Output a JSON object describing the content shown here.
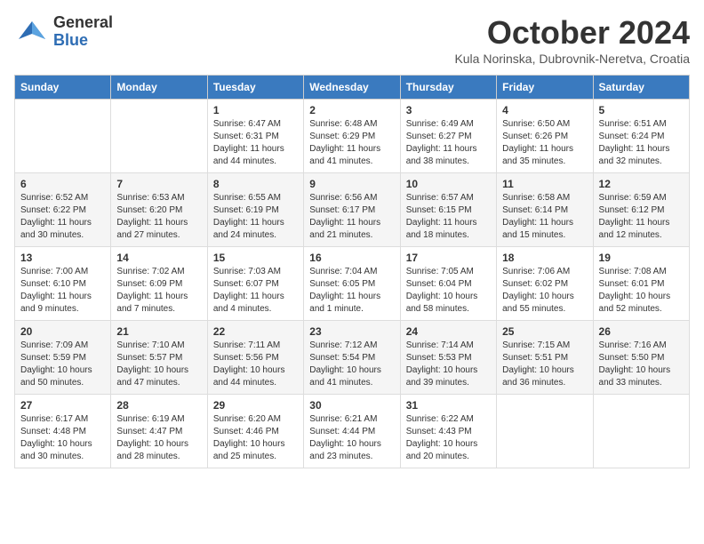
{
  "header": {
    "logo_general": "General",
    "logo_blue": "Blue",
    "month": "October 2024",
    "location": "Kula Norinska, Dubrovnik-Neretva, Croatia"
  },
  "days_of_week": [
    "Sunday",
    "Monday",
    "Tuesday",
    "Wednesday",
    "Thursday",
    "Friday",
    "Saturday"
  ],
  "weeks": [
    [
      {
        "day": "",
        "info": ""
      },
      {
        "day": "",
        "info": ""
      },
      {
        "day": "1",
        "info": "Sunrise: 6:47 AM\nSunset: 6:31 PM\nDaylight: 11 hours and 44 minutes."
      },
      {
        "day": "2",
        "info": "Sunrise: 6:48 AM\nSunset: 6:29 PM\nDaylight: 11 hours and 41 minutes."
      },
      {
        "day": "3",
        "info": "Sunrise: 6:49 AM\nSunset: 6:27 PM\nDaylight: 11 hours and 38 minutes."
      },
      {
        "day": "4",
        "info": "Sunrise: 6:50 AM\nSunset: 6:26 PM\nDaylight: 11 hours and 35 minutes."
      },
      {
        "day": "5",
        "info": "Sunrise: 6:51 AM\nSunset: 6:24 PM\nDaylight: 11 hours and 32 minutes."
      }
    ],
    [
      {
        "day": "6",
        "info": "Sunrise: 6:52 AM\nSunset: 6:22 PM\nDaylight: 11 hours and 30 minutes."
      },
      {
        "day": "7",
        "info": "Sunrise: 6:53 AM\nSunset: 6:20 PM\nDaylight: 11 hours and 27 minutes."
      },
      {
        "day": "8",
        "info": "Sunrise: 6:55 AM\nSunset: 6:19 PM\nDaylight: 11 hours and 24 minutes."
      },
      {
        "day": "9",
        "info": "Sunrise: 6:56 AM\nSunset: 6:17 PM\nDaylight: 11 hours and 21 minutes."
      },
      {
        "day": "10",
        "info": "Sunrise: 6:57 AM\nSunset: 6:15 PM\nDaylight: 11 hours and 18 minutes."
      },
      {
        "day": "11",
        "info": "Sunrise: 6:58 AM\nSunset: 6:14 PM\nDaylight: 11 hours and 15 minutes."
      },
      {
        "day": "12",
        "info": "Sunrise: 6:59 AM\nSunset: 6:12 PM\nDaylight: 11 hours and 12 minutes."
      }
    ],
    [
      {
        "day": "13",
        "info": "Sunrise: 7:00 AM\nSunset: 6:10 PM\nDaylight: 11 hours and 9 minutes."
      },
      {
        "day": "14",
        "info": "Sunrise: 7:02 AM\nSunset: 6:09 PM\nDaylight: 11 hours and 7 minutes."
      },
      {
        "day": "15",
        "info": "Sunrise: 7:03 AM\nSunset: 6:07 PM\nDaylight: 11 hours and 4 minutes."
      },
      {
        "day": "16",
        "info": "Sunrise: 7:04 AM\nSunset: 6:05 PM\nDaylight: 11 hours and 1 minute."
      },
      {
        "day": "17",
        "info": "Sunrise: 7:05 AM\nSunset: 6:04 PM\nDaylight: 10 hours and 58 minutes."
      },
      {
        "day": "18",
        "info": "Sunrise: 7:06 AM\nSunset: 6:02 PM\nDaylight: 10 hours and 55 minutes."
      },
      {
        "day": "19",
        "info": "Sunrise: 7:08 AM\nSunset: 6:01 PM\nDaylight: 10 hours and 52 minutes."
      }
    ],
    [
      {
        "day": "20",
        "info": "Sunrise: 7:09 AM\nSunset: 5:59 PM\nDaylight: 10 hours and 50 minutes."
      },
      {
        "day": "21",
        "info": "Sunrise: 7:10 AM\nSunset: 5:57 PM\nDaylight: 10 hours and 47 minutes."
      },
      {
        "day": "22",
        "info": "Sunrise: 7:11 AM\nSunset: 5:56 PM\nDaylight: 10 hours and 44 minutes."
      },
      {
        "day": "23",
        "info": "Sunrise: 7:12 AM\nSunset: 5:54 PM\nDaylight: 10 hours and 41 minutes."
      },
      {
        "day": "24",
        "info": "Sunrise: 7:14 AM\nSunset: 5:53 PM\nDaylight: 10 hours and 39 minutes."
      },
      {
        "day": "25",
        "info": "Sunrise: 7:15 AM\nSunset: 5:51 PM\nDaylight: 10 hours and 36 minutes."
      },
      {
        "day": "26",
        "info": "Sunrise: 7:16 AM\nSunset: 5:50 PM\nDaylight: 10 hours and 33 minutes."
      }
    ],
    [
      {
        "day": "27",
        "info": "Sunrise: 6:17 AM\nSunset: 4:48 PM\nDaylight: 10 hours and 30 minutes."
      },
      {
        "day": "28",
        "info": "Sunrise: 6:19 AM\nSunset: 4:47 PM\nDaylight: 10 hours and 28 minutes."
      },
      {
        "day": "29",
        "info": "Sunrise: 6:20 AM\nSunset: 4:46 PM\nDaylight: 10 hours and 25 minutes."
      },
      {
        "day": "30",
        "info": "Sunrise: 6:21 AM\nSunset: 4:44 PM\nDaylight: 10 hours and 23 minutes."
      },
      {
        "day": "31",
        "info": "Sunrise: 6:22 AM\nSunset: 4:43 PM\nDaylight: 10 hours and 20 minutes."
      },
      {
        "day": "",
        "info": ""
      },
      {
        "day": "",
        "info": ""
      }
    ]
  ]
}
